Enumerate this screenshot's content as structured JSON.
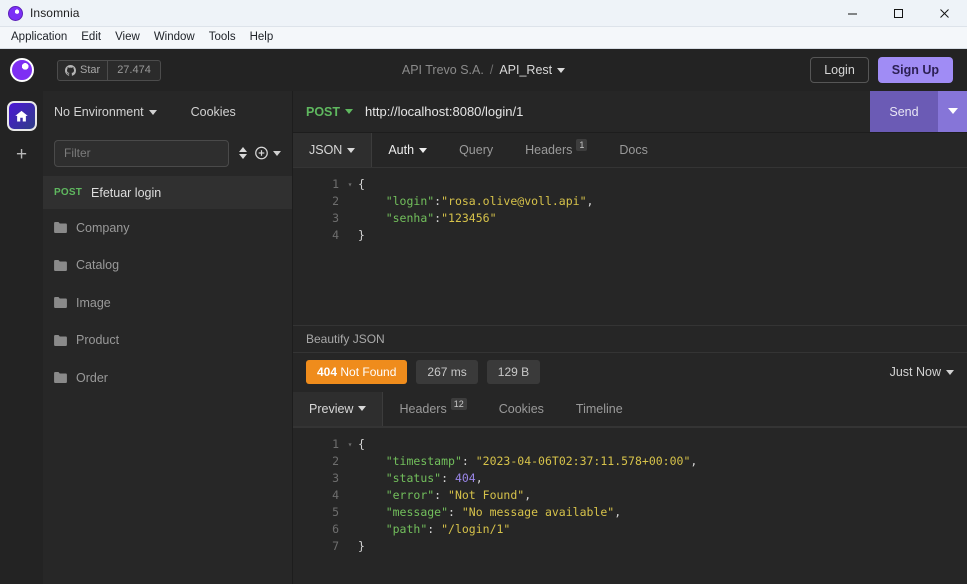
{
  "window": {
    "title": "Insomnia",
    "logo_icon": "insomnia-logo-icon",
    "minimize_icon": "minimize-icon",
    "maximize_icon": "maximize-icon",
    "close_icon": "close-icon"
  },
  "menubar": {
    "items": [
      {
        "label": "Application"
      },
      {
        "label": "Edit"
      },
      {
        "label": "View"
      },
      {
        "label": "Window"
      },
      {
        "label": "Tools"
      },
      {
        "label": "Help"
      }
    ]
  },
  "appbar": {
    "logo_icon": "insomnia-logo-icon",
    "github_star": {
      "icon": "github-icon",
      "label": "Star",
      "count": "27.474"
    },
    "breadcrumb": {
      "workspace": "API Trevo S.A.",
      "separator": "/",
      "current": "API_Rest",
      "caret_icon": "chevron-down-icon"
    },
    "login_label": "Login",
    "signup_label": "Sign Up",
    "signup_color": "#a08cf5"
  },
  "rail": {
    "home_icon": "home-icon",
    "add_icon": "plus-icon"
  },
  "sidebar": {
    "environment_label": "No Environment",
    "environment_caret_icon": "chevron-down-icon",
    "cookies_label": "Cookies",
    "filter_placeholder": "Filter",
    "filter_value": "",
    "sort_icon": "sort-icon",
    "add_icon": "plus-circle-icon",
    "add_caret_icon": "chevron-down-icon",
    "request": {
      "method": "POST",
      "name": "Efetuar login"
    },
    "folders": [
      {
        "label": "Company",
        "icon": "folder-icon"
      },
      {
        "label": "Catalog",
        "icon": "folder-icon"
      },
      {
        "label": "Image",
        "icon": "folder-icon"
      },
      {
        "label": "Product",
        "icon": "folder-icon"
      },
      {
        "label": "Order",
        "icon": "folder-icon"
      }
    ]
  },
  "request": {
    "method": "POST",
    "method_caret_icon": "chevron-down-icon",
    "url": "http://localhost:8080/login/1",
    "send_label": "Send",
    "send_caret_icon": "chevron-down-icon",
    "tabs": [
      {
        "label": "JSON",
        "caret_icon": "chevron-down-icon",
        "active": true,
        "badge": ""
      },
      {
        "label": "Auth",
        "caret_icon": "chevron-down-icon",
        "active": false,
        "badge": ""
      },
      {
        "label": "Query",
        "caret_icon": "",
        "active": false,
        "badge": ""
      },
      {
        "label": "Headers",
        "caret_icon": "",
        "active": false,
        "badge": "1"
      },
      {
        "label": "Docs",
        "caret_icon": "",
        "active": false,
        "badge": ""
      }
    ],
    "body_lines": [
      {
        "n": "1",
        "fold": "▾",
        "tokens": [
          {
            "t": "{",
            "c": "c-punc"
          }
        ]
      },
      {
        "n": "2",
        "fold": "",
        "tokens": [
          {
            "t": "    ",
            "c": "c-punc"
          },
          {
            "t": "\"login\"",
            "c": "c-key"
          },
          {
            "t": ":",
            "c": "c-punc"
          },
          {
            "t": "\"rosa.olive@voll.api\"",
            "c": "c-str"
          },
          {
            "t": ",",
            "c": "c-punc"
          }
        ]
      },
      {
        "n": "3",
        "fold": "",
        "tokens": [
          {
            "t": "    ",
            "c": "c-punc"
          },
          {
            "t": "\"senha\"",
            "c": "c-key"
          },
          {
            "t": ":",
            "c": "c-punc"
          },
          {
            "t": "\"123456\"",
            "c": "c-str"
          }
        ]
      },
      {
        "n": "4",
        "fold": "",
        "tokens": [
          {
            "t": "}",
            "c": "c-punc"
          }
        ]
      }
    ],
    "beautify_label": "Beautify JSON"
  },
  "response": {
    "status_code": "404",
    "status_text": "Not Found",
    "status_color": "#ef8c1c",
    "time": "267 ms",
    "size": "129 B",
    "timestamp_label": "Just Now",
    "timestamp_caret_icon": "chevron-down-icon",
    "tabs": [
      {
        "label": "Preview",
        "caret_icon": "chevron-down-icon",
        "active": true,
        "badge": ""
      },
      {
        "label": "Headers",
        "caret_icon": "",
        "active": false,
        "badge": "12"
      },
      {
        "label": "Cookies",
        "caret_icon": "",
        "active": false,
        "badge": ""
      },
      {
        "label": "Timeline",
        "caret_icon": "",
        "active": false,
        "badge": ""
      }
    ],
    "body_lines": [
      {
        "n": "1",
        "fold": "▾",
        "tokens": [
          {
            "t": "{",
            "c": "c-punc"
          }
        ]
      },
      {
        "n": "2",
        "fold": "",
        "tokens": [
          {
            "t": "    ",
            "c": "c-punc"
          },
          {
            "t": "\"timestamp\"",
            "c": "c-key"
          },
          {
            "t": ": ",
            "c": "c-punc"
          },
          {
            "t": "\"2023-04-06T02:37:11.578+00:00\"",
            "c": "c-str"
          },
          {
            "t": ",",
            "c": "c-punc"
          }
        ]
      },
      {
        "n": "3",
        "fold": "",
        "tokens": [
          {
            "t": "    ",
            "c": "c-punc"
          },
          {
            "t": "\"status\"",
            "c": "c-key"
          },
          {
            "t": ": ",
            "c": "c-punc"
          },
          {
            "t": "404",
            "c": "c-num"
          },
          {
            "t": ",",
            "c": "c-punc"
          }
        ]
      },
      {
        "n": "4",
        "fold": "",
        "tokens": [
          {
            "t": "    ",
            "c": "c-punc"
          },
          {
            "t": "\"error\"",
            "c": "c-key"
          },
          {
            "t": ": ",
            "c": "c-punc"
          },
          {
            "t": "\"Not Found\"",
            "c": "c-str"
          },
          {
            "t": ",",
            "c": "c-punc"
          }
        ]
      },
      {
        "n": "5",
        "fold": "",
        "tokens": [
          {
            "t": "    ",
            "c": "c-punc"
          },
          {
            "t": "\"message\"",
            "c": "c-key"
          },
          {
            "t": ": ",
            "c": "c-punc"
          },
          {
            "t": "\"No message available\"",
            "c": "c-str"
          },
          {
            "t": ",",
            "c": "c-punc"
          }
        ]
      },
      {
        "n": "6",
        "fold": "",
        "tokens": [
          {
            "t": "    ",
            "c": "c-punc"
          },
          {
            "t": "\"path\"",
            "c": "c-key"
          },
          {
            "t": ": ",
            "c": "c-punc"
          },
          {
            "t": "\"/login/1\"",
            "c": "c-str"
          }
        ]
      },
      {
        "n": "7",
        "fold": "",
        "tokens": [
          {
            "t": "}",
            "c": "c-punc"
          }
        ]
      }
    ]
  }
}
